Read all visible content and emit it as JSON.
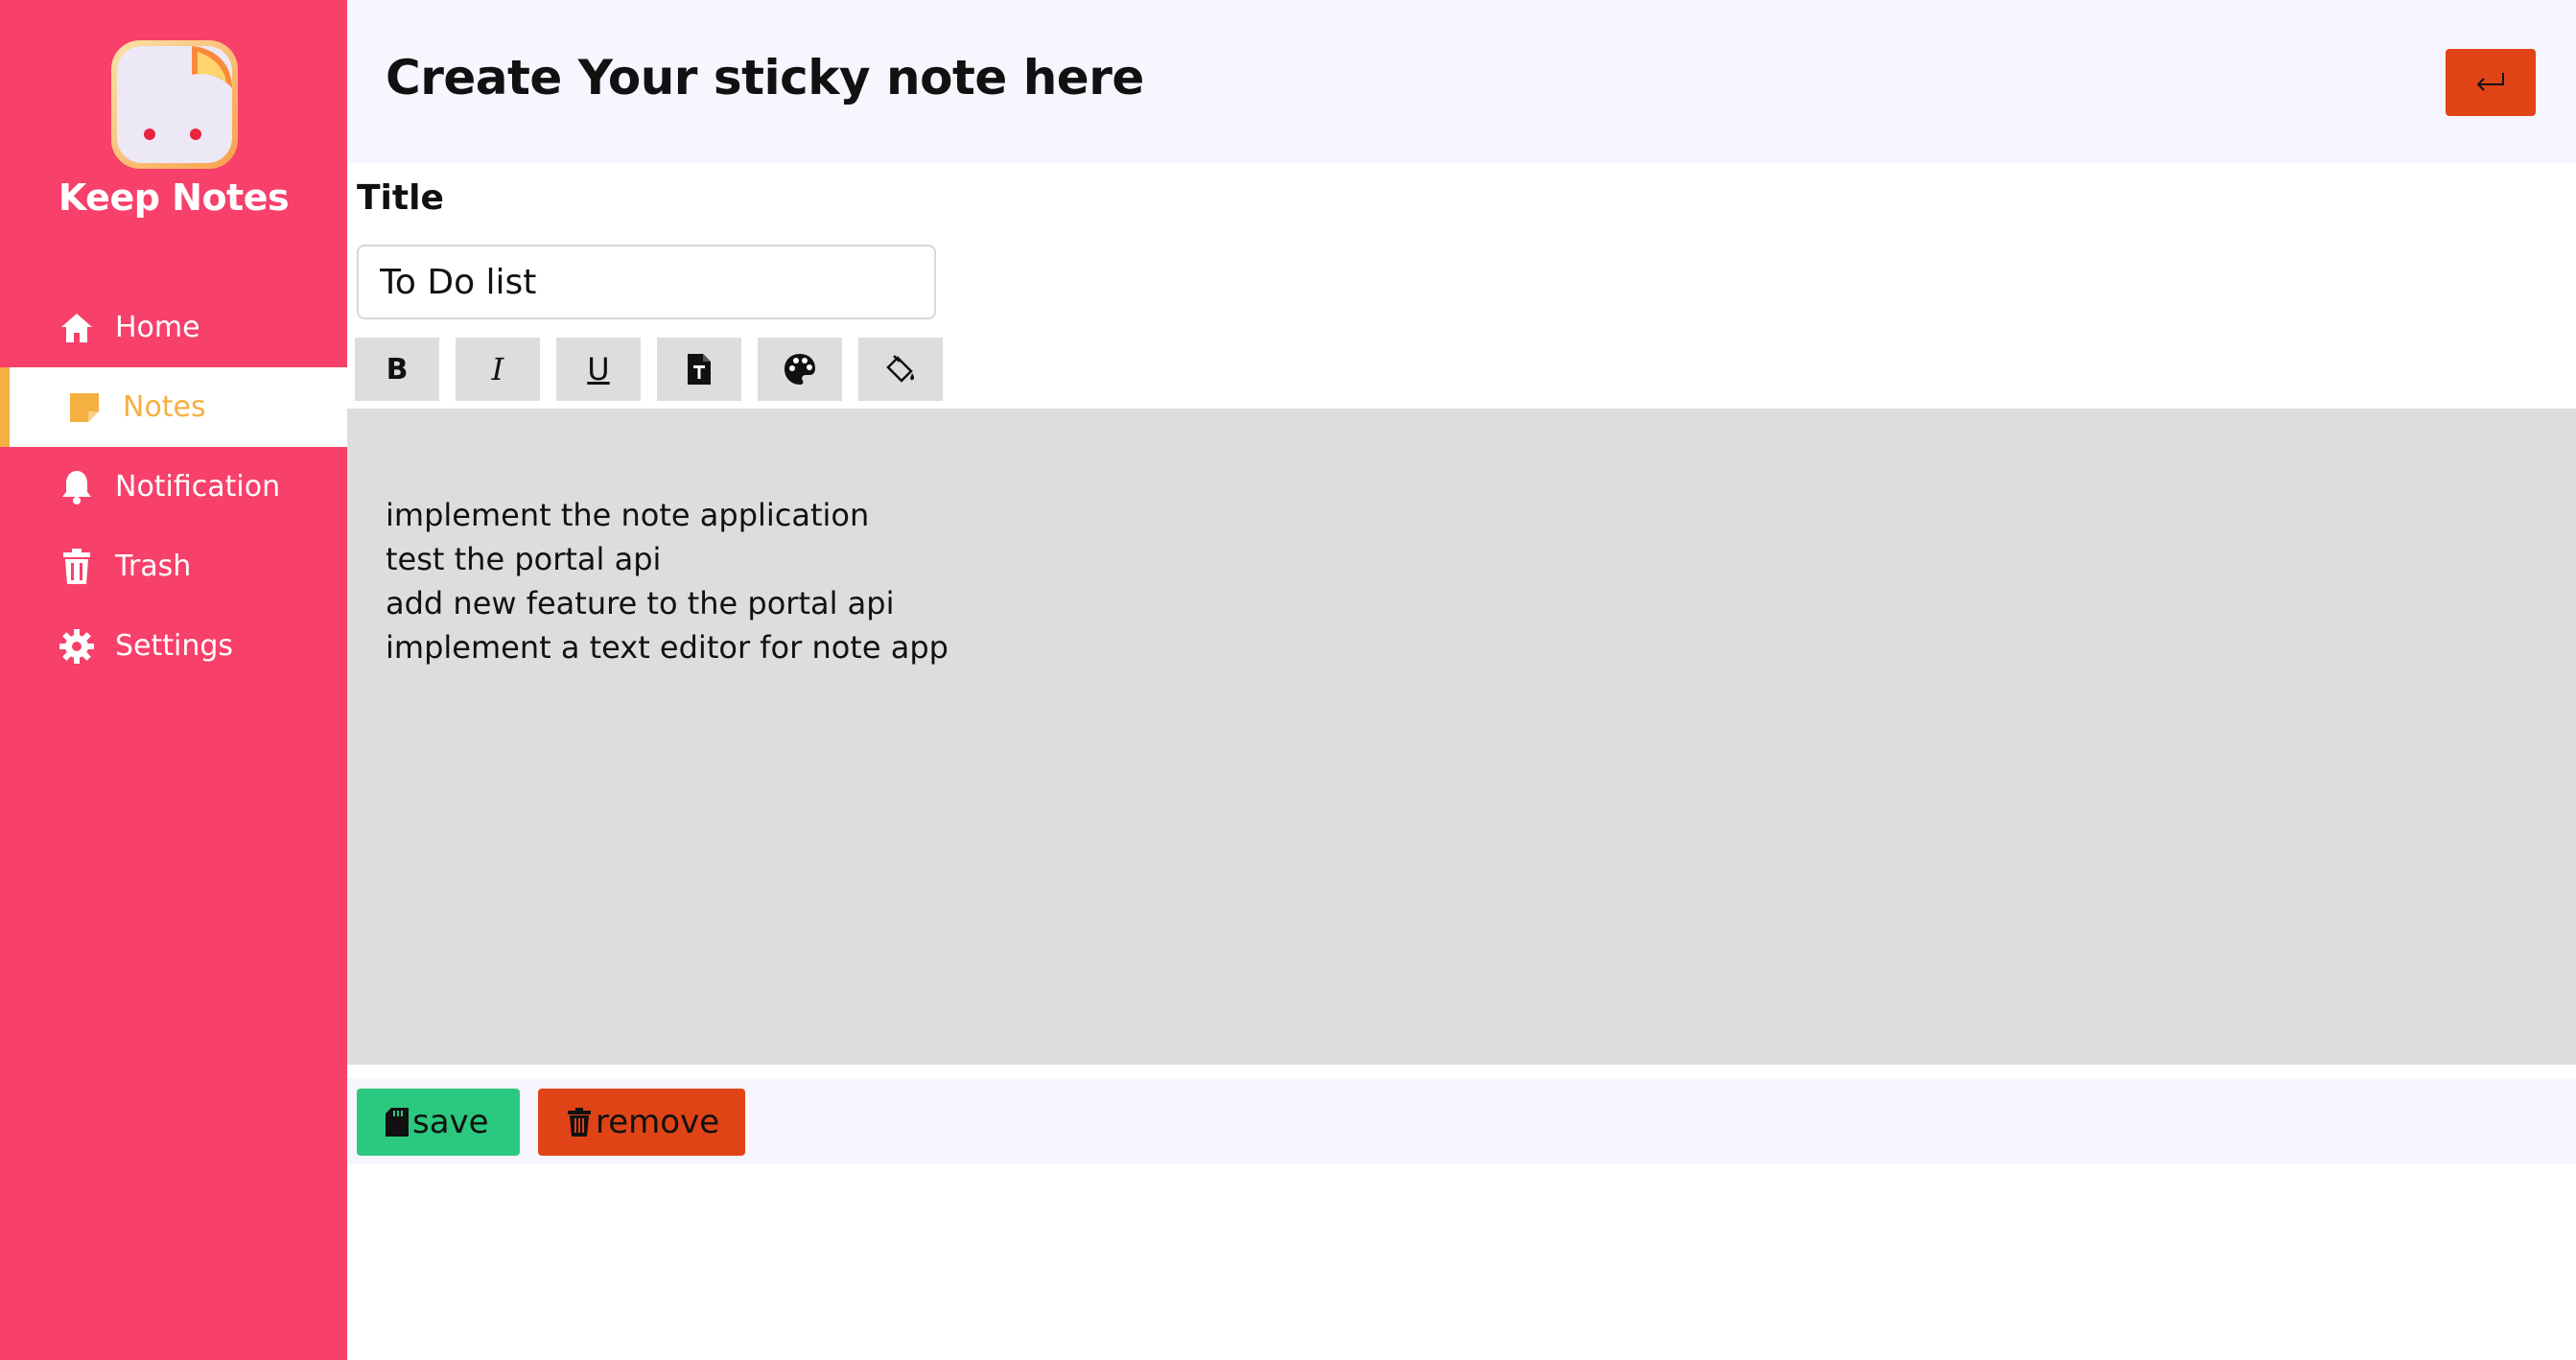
{
  "sidebar": {
    "brand": "Keep Notes",
    "items": [
      {
        "label": "Home",
        "icon": "home-icon"
      },
      {
        "label": "Notes",
        "icon": "sticky-note-icon",
        "active": true
      },
      {
        "label": "Notification",
        "icon": "bell-icon"
      },
      {
        "label": "Trash",
        "icon": "trash-icon"
      },
      {
        "label": "Settings",
        "icon": "gear-icon"
      }
    ]
  },
  "header": {
    "title": "Create Your sticky note here",
    "back_icon": "return-arrow-icon"
  },
  "form": {
    "title_label": "Title",
    "title_value": "To Do list"
  },
  "toolbar": {
    "bold": "B",
    "italic": "I",
    "underline": "U"
  },
  "editor": {
    "lines": [
      "implement the note application",
      "test the portal api",
      "add new feature to the portal api",
      "implement a text editor for note app"
    ]
  },
  "actions": {
    "save_label": "save",
    "remove_label": "remove"
  },
  "colors": {
    "sidebar": "#f7406a",
    "active_accent": "#f5b042",
    "save": "#2bc97f",
    "remove": "#e04316"
  }
}
